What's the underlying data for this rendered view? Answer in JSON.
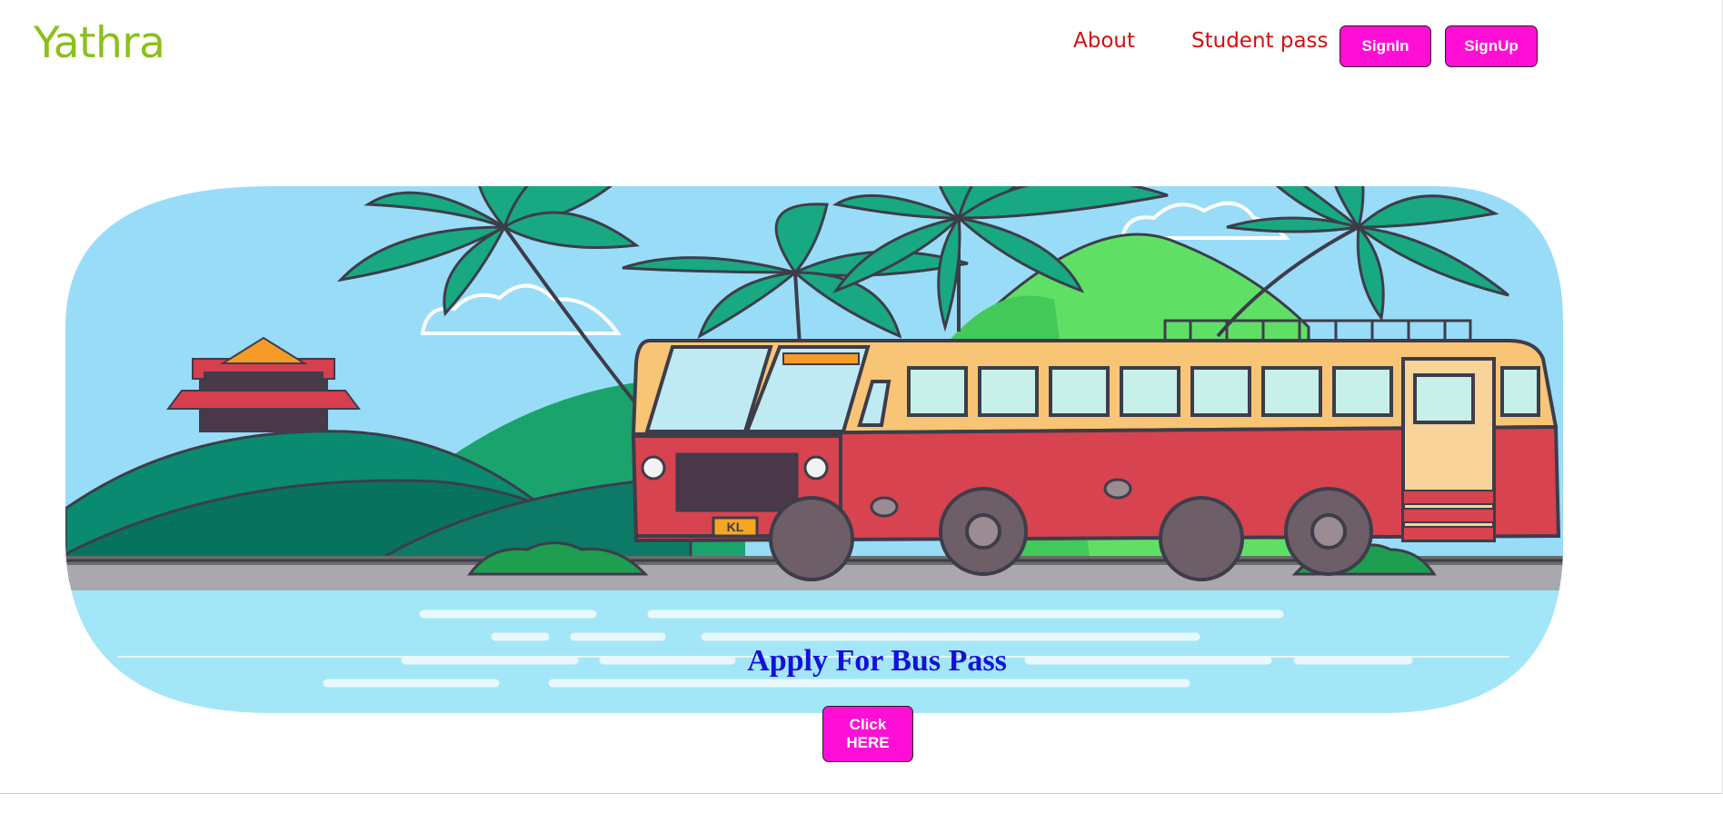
{
  "header": {
    "brand": "Yathra",
    "nav": {
      "about": "About",
      "student_pass": "Student pass"
    },
    "buttons": {
      "signin": "SignIn",
      "signup": "SignUp"
    }
  },
  "hero": {
    "image": "bus-illustration",
    "bus_plate": "KL"
  },
  "cta": {
    "title": "Apply For Bus Pass",
    "button_line1": "Click",
    "button_line2": "HERE"
  },
  "colors": {
    "brand": "#8bc019",
    "nav_link": "#d50e0e",
    "button_bg": "#ff0fd5",
    "cta_title": "#1212d6"
  }
}
